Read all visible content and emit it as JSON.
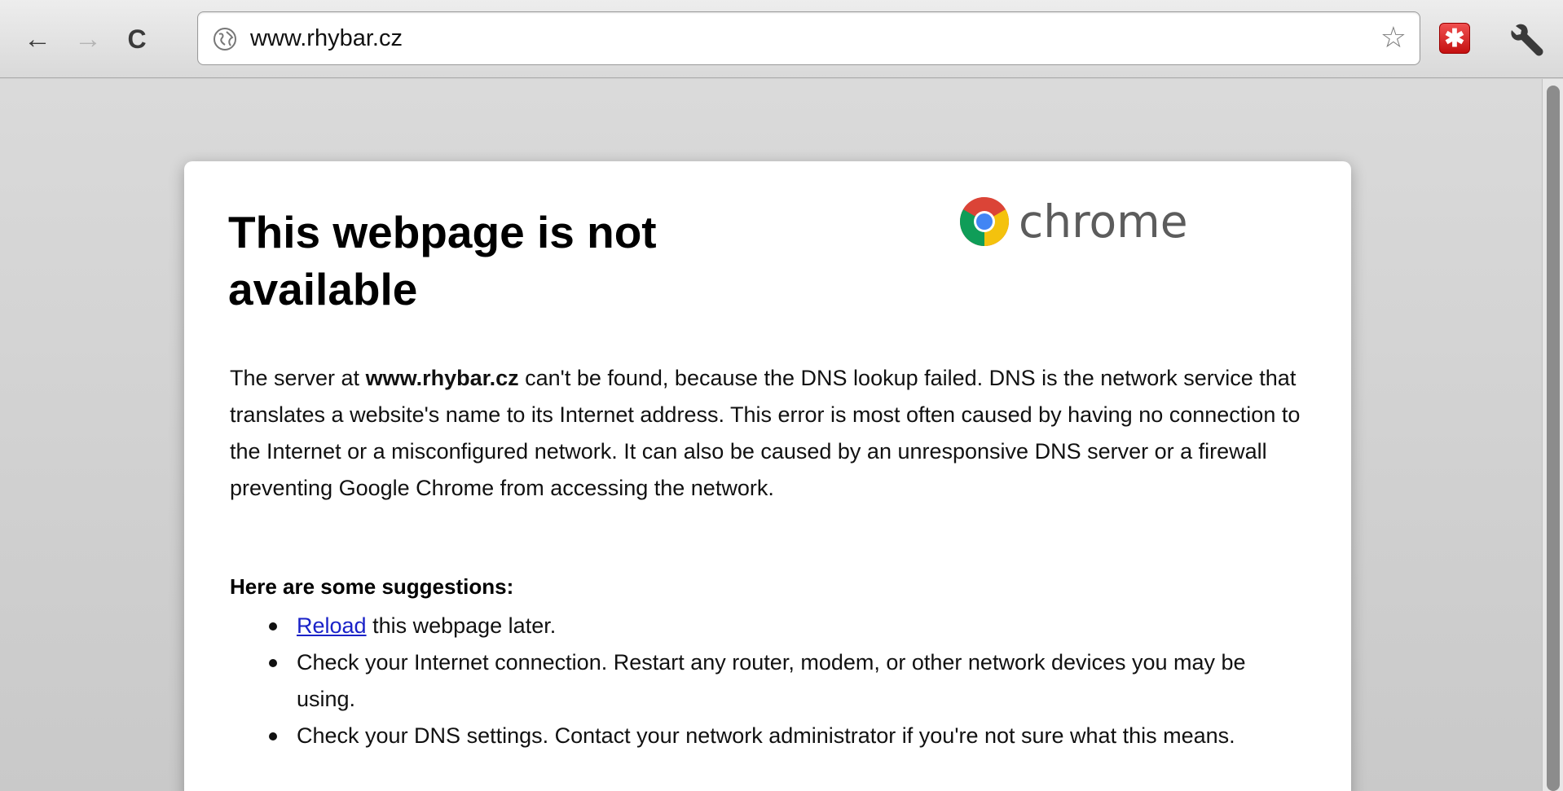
{
  "toolbar": {
    "back_icon": "←",
    "forward_icon": "→",
    "reload_icon": "C",
    "url": "www.rhybar.cz",
    "star_icon": "☆",
    "ext_icon": "✱"
  },
  "page": {
    "title": "This webpage is not available",
    "logo_text": "chrome",
    "desc": {
      "prefix": "The server at ",
      "host": "www.rhybar.cz",
      "suffix": " can't be found, because the DNS lookup failed. DNS is the network service that translates a website's name to its Internet address. This error is most often caused by having no connection to the Internet or a misconfigured network. It can also be caused by an unresponsive DNS server or a firewall preventing Google Chrome from accessing the network."
    },
    "suggestions_heading": "Here are some suggestions:",
    "suggestions": {
      "reload_link": "Reload",
      "reload_rest": " this webpage later.",
      "item2": "Check your Internet connection. Restart any router, modem, or other network devices you may be using.",
      "item3": "Check your DNS settings. Contact your network administrator if you're not sure what this means."
    }
  }
}
